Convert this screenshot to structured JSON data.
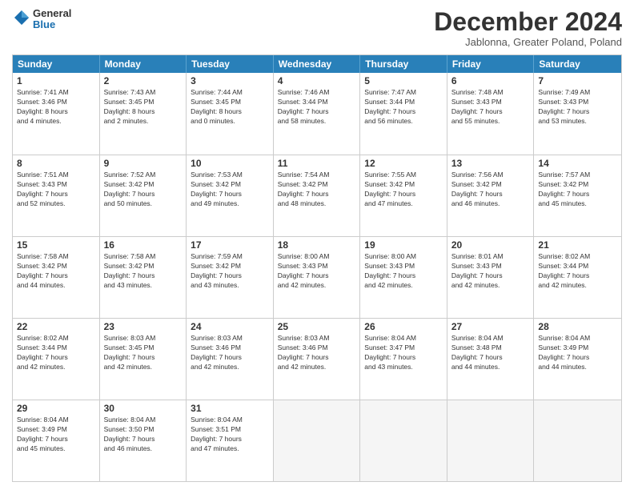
{
  "logo": {
    "general": "General",
    "blue": "Blue"
  },
  "header": {
    "month": "December 2024",
    "location": "Jablonna, Greater Poland, Poland"
  },
  "weekdays": [
    "Sunday",
    "Monday",
    "Tuesday",
    "Wednesday",
    "Thursday",
    "Friday",
    "Saturday"
  ],
  "weeks": [
    [
      {
        "day": "1",
        "lines": [
          "Sunrise: 7:41 AM",
          "Sunset: 3:46 PM",
          "Daylight: 8 hours",
          "and 4 minutes."
        ]
      },
      {
        "day": "2",
        "lines": [
          "Sunrise: 7:43 AM",
          "Sunset: 3:45 PM",
          "Daylight: 8 hours",
          "and 2 minutes."
        ]
      },
      {
        "day": "3",
        "lines": [
          "Sunrise: 7:44 AM",
          "Sunset: 3:45 PM",
          "Daylight: 8 hours",
          "and 0 minutes."
        ]
      },
      {
        "day": "4",
        "lines": [
          "Sunrise: 7:46 AM",
          "Sunset: 3:44 PM",
          "Daylight: 7 hours",
          "and 58 minutes."
        ]
      },
      {
        "day": "5",
        "lines": [
          "Sunrise: 7:47 AM",
          "Sunset: 3:44 PM",
          "Daylight: 7 hours",
          "and 56 minutes."
        ]
      },
      {
        "day": "6",
        "lines": [
          "Sunrise: 7:48 AM",
          "Sunset: 3:43 PM",
          "Daylight: 7 hours",
          "and 55 minutes."
        ]
      },
      {
        "day": "7",
        "lines": [
          "Sunrise: 7:49 AM",
          "Sunset: 3:43 PM",
          "Daylight: 7 hours",
          "and 53 minutes."
        ]
      }
    ],
    [
      {
        "day": "8",
        "lines": [
          "Sunrise: 7:51 AM",
          "Sunset: 3:43 PM",
          "Daylight: 7 hours",
          "and 52 minutes."
        ]
      },
      {
        "day": "9",
        "lines": [
          "Sunrise: 7:52 AM",
          "Sunset: 3:42 PM",
          "Daylight: 7 hours",
          "and 50 minutes."
        ]
      },
      {
        "day": "10",
        "lines": [
          "Sunrise: 7:53 AM",
          "Sunset: 3:42 PM",
          "Daylight: 7 hours",
          "and 49 minutes."
        ]
      },
      {
        "day": "11",
        "lines": [
          "Sunrise: 7:54 AM",
          "Sunset: 3:42 PM",
          "Daylight: 7 hours",
          "and 48 minutes."
        ]
      },
      {
        "day": "12",
        "lines": [
          "Sunrise: 7:55 AM",
          "Sunset: 3:42 PM",
          "Daylight: 7 hours",
          "and 47 minutes."
        ]
      },
      {
        "day": "13",
        "lines": [
          "Sunrise: 7:56 AM",
          "Sunset: 3:42 PM",
          "Daylight: 7 hours",
          "and 46 minutes."
        ]
      },
      {
        "day": "14",
        "lines": [
          "Sunrise: 7:57 AM",
          "Sunset: 3:42 PM",
          "Daylight: 7 hours",
          "and 45 minutes."
        ]
      }
    ],
    [
      {
        "day": "15",
        "lines": [
          "Sunrise: 7:58 AM",
          "Sunset: 3:42 PM",
          "Daylight: 7 hours",
          "and 44 minutes."
        ]
      },
      {
        "day": "16",
        "lines": [
          "Sunrise: 7:58 AM",
          "Sunset: 3:42 PM",
          "Daylight: 7 hours",
          "and 43 minutes."
        ]
      },
      {
        "day": "17",
        "lines": [
          "Sunrise: 7:59 AM",
          "Sunset: 3:42 PM",
          "Daylight: 7 hours",
          "and 43 minutes."
        ]
      },
      {
        "day": "18",
        "lines": [
          "Sunrise: 8:00 AM",
          "Sunset: 3:43 PM",
          "Daylight: 7 hours",
          "and 42 minutes."
        ]
      },
      {
        "day": "19",
        "lines": [
          "Sunrise: 8:00 AM",
          "Sunset: 3:43 PM",
          "Daylight: 7 hours",
          "and 42 minutes."
        ]
      },
      {
        "day": "20",
        "lines": [
          "Sunrise: 8:01 AM",
          "Sunset: 3:43 PM",
          "Daylight: 7 hours",
          "and 42 minutes."
        ]
      },
      {
        "day": "21",
        "lines": [
          "Sunrise: 8:02 AM",
          "Sunset: 3:44 PM",
          "Daylight: 7 hours",
          "and 42 minutes."
        ]
      }
    ],
    [
      {
        "day": "22",
        "lines": [
          "Sunrise: 8:02 AM",
          "Sunset: 3:44 PM",
          "Daylight: 7 hours",
          "and 42 minutes."
        ]
      },
      {
        "day": "23",
        "lines": [
          "Sunrise: 8:03 AM",
          "Sunset: 3:45 PM",
          "Daylight: 7 hours",
          "and 42 minutes."
        ]
      },
      {
        "day": "24",
        "lines": [
          "Sunrise: 8:03 AM",
          "Sunset: 3:46 PM",
          "Daylight: 7 hours",
          "and 42 minutes."
        ]
      },
      {
        "day": "25",
        "lines": [
          "Sunrise: 8:03 AM",
          "Sunset: 3:46 PM",
          "Daylight: 7 hours",
          "and 42 minutes."
        ]
      },
      {
        "day": "26",
        "lines": [
          "Sunrise: 8:04 AM",
          "Sunset: 3:47 PM",
          "Daylight: 7 hours",
          "and 43 minutes."
        ]
      },
      {
        "day": "27",
        "lines": [
          "Sunrise: 8:04 AM",
          "Sunset: 3:48 PM",
          "Daylight: 7 hours",
          "and 44 minutes."
        ]
      },
      {
        "day": "28",
        "lines": [
          "Sunrise: 8:04 AM",
          "Sunset: 3:49 PM",
          "Daylight: 7 hours",
          "and 44 minutes."
        ]
      }
    ],
    [
      {
        "day": "29",
        "lines": [
          "Sunrise: 8:04 AM",
          "Sunset: 3:49 PM",
          "Daylight: 7 hours",
          "and 45 minutes."
        ]
      },
      {
        "day": "30",
        "lines": [
          "Sunrise: 8:04 AM",
          "Sunset: 3:50 PM",
          "Daylight: 7 hours",
          "and 46 minutes."
        ]
      },
      {
        "day": "31",
        "lines": [
          "Sunrise: 8:04 AM",
          "Sunset: 3:51 PM",
          "Daylight: 7 hours",
          "and 47 minutes."
        ]
      },
      {
        "day": "",
        "lines": []
      },
      {
        "day": "",
        "lines": []
      },
      {
        "day": "",
        "lines": []
      },
      {
        "day": "",
        "lines": []
      }
    ]
  ]
}
